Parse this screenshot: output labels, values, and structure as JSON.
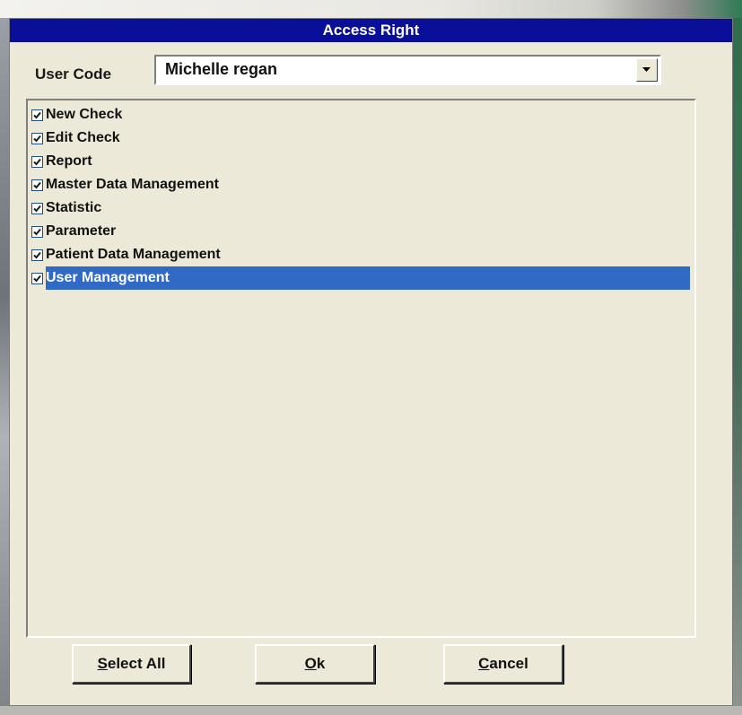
{
  "dialog": {
    "title": "Access Right"
  },
  "user_code": {
    "label": "User Code",
    "value": "Michelle regan"
  },
  "rights": [
    {
      "label": "New Check",
      "checked": true,
      "selected": false
    },
    {
      "label": "Edit Check",
      "checked": true,
      "selected": false
    },
    {
      "label": "Report",
      "checked": true,
      "selected": false
    },
    {
      "label": "Master Data Management",
      "checked": true,
      "selected": false
    },
    {
      "label": "Statistic",
      "checked": true,
      "selected": false
    },
    {
      "label": "Parameter",
      "checked": true,
      "selected": false
    },
    {
      "label": "Patient Data Management",
      "checked": true,
      "selected": false
    },
    {
      "label": "User Management",
      "checked": true,
      "selected": true
    }
  ],
  "buttons": {
    "select_all": {
      "accel": "S",
      "rest": "elect All"
    },
    "ok": {
      "accel": "O",
      "rest": "k"
    },
    "cancel": {
      "accel": "C",
      "rest": "ancel"
    }
  },
  "colors": {
    "title_bar": "#0a0f9a",
    "selection": "#316ac5",
    "dialog_bg": "#ece9d8"
  }
}
